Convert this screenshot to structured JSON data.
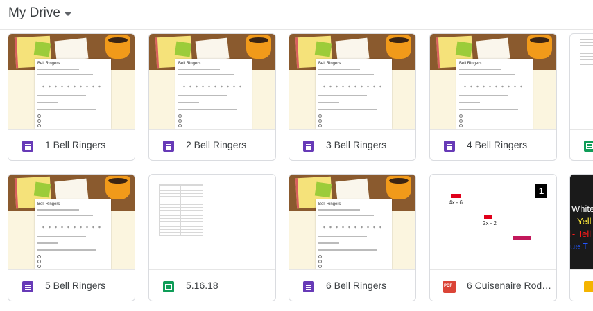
{
  "header": {
    "title": "My Drive"
  },
  "form_thumb": {
    "title": "Bell Ringers",
    "q1": "Mental Math Monday: Enter your total correct.",
    "q2": "Tough Cases Tuesday: Enter your estimate.",
    "q3": "Which One Wednesday: Which one does not belong?"
  },
  "files": [
    {
      "name": "1 Bell Ringers"
    },
    {
      "name": "2 Bell Ringers"
    },
    {
      "name": "3 Bell Ringers"
    },
    {
      "name": "4 Bell Ringers"
    },
    {
      "name": "5 Bell Ringers"
    },
    {
      "name": "5.16.18"
    },
    {
      "name": "6 Bell Ringers"
    },
    {
      "name": "6 Cuisenaire Rod I..."
    }
  ],
  "cuisenaire": {
    "label1": "4x - 6",
    "label2": "2x - 2",
    "badge": "1"
  },
  "partial_slide": {
    "line1": "White",
    "line2": "Yell",
    "line3": "l- Tell",
    "line4": "ue T"
  },
  "colors": {
    "forms": "#673ab7",
    "sheets": "#0f9d58",
    "pdf": "#db4437",
    "slides": "#f4b400"
  }
}
